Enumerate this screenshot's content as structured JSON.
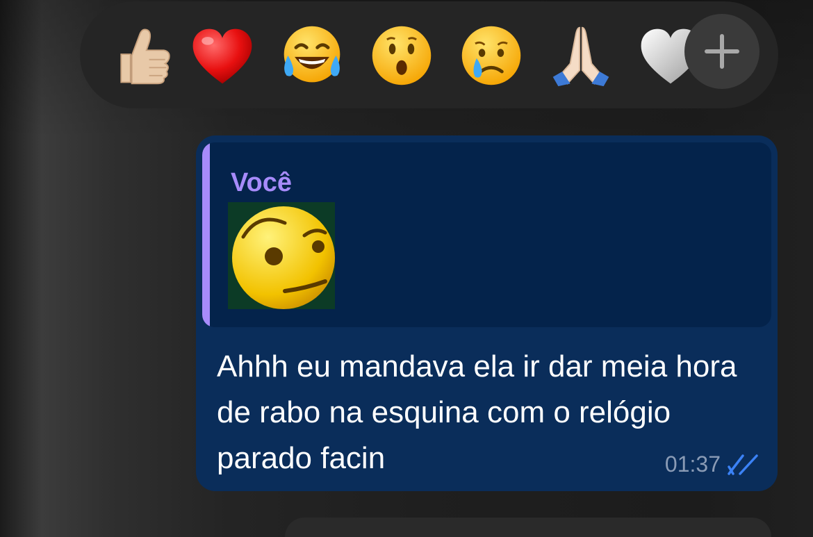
{
  "reactions": [
    {
      "icon": "thumbs-up-icon"
    },
    {
      "icon": "red-heart-icon"
    },
    {
      "icon": "tears-of-joy-icon"
    },
    {
      "icon": "surprised-face-icon"
    },
    {
      "icon": "crying-face-icon"
    },
    {
      "icon": "folded-hands-icon"
    },
    {
      "icon": "white-heart-icon"
    }
  ],
  "add_reaction": {
    "icon": "plus-icon"
  },
  "message": {
    "quote": {
      "author": "Você",
      "thumbnail_icon": "raised-eyebrow-face-icon"
    },
    "text": "Ahhh eu mandava ela ir dar meia hora de rabo na esquina com o relógio parado facin",
    "time": "01:37",
    "status_icon": "double-check-icon"
  },
  "colors": {
    "bubble": "#0a2d5a",
    "quote_bg": "#04234b",
    "quote_accent": "#a78bfa",
    "read_ticks": "#3b82f6",
    "reaction_bar": "#252525"
  }
}
